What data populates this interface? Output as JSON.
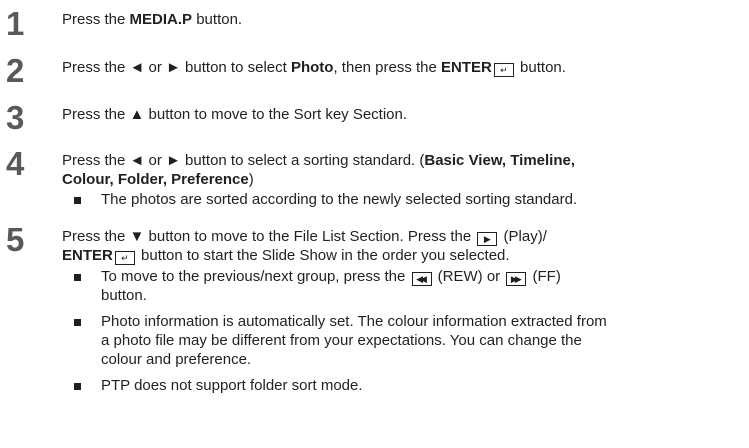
{
  "steps": [
    {
      "number": "1",
      "pre": "Press the ",
      "bold": "MEDIA.P",
      "post": " button."
    },
    {
      "number": "2",
      "pre": "Press the ◄ or ► button to select ",
      "bold1": "Photo",
      "mid": ", then press the ",
      "bold2": "ENTER",
      "post": " button."
    },
    {
      "number": "3",
      "text": "Press the ▲ button to move to the Sort key Section."
    },
    {
      "number": "4",
      "line1_pre": "Press the ◄ or ► button to select a sorting standard. (",
      "line1_bold": "Basic View, Timeline,",
      "line2_bold": "Colour, Folder, Preference",
      "line2_post": ")",
      "bullets": [
        "The photos are sorted according to the newly selected sorting standard."
      ]
    },
    {
      "number": "5",
      "line1": "Press the ▼ button to move to the File List Section. Press the ",
      "line1_post": " (Play)/",
      "line2_bold": "ENTER",
      "line2_post": " button to start the Slide Show in the order you selected.",
      "bullets": [
        {
          "line1_pre": "To move to the previous/next group, press the ",
          "line1_mid": " (REW) or ",
          "line1_post": " (FF)",
          "line2": "button."
        },
        {
          "line1": "Photo information is automatically set. The colour information extracted from",
          "line2": "a photo file may be different from your expectations. You can change the",
          "line3": "colour and preference."
        },
        {
          "line1": "PTP does not support folder sort mode."
        }
      ]
    }
  ],
  "icons": {
    "enter": "enter-key-icon",
    "play": "play-key-icon",
    "rew": "rew-key-icon",
    "ff": "ff-key-icon",
    "bullet": "square-bullet-icon"
  },
  "colors": {
    "number": "#58595b",
    "text": "#231f20"
  }
}
